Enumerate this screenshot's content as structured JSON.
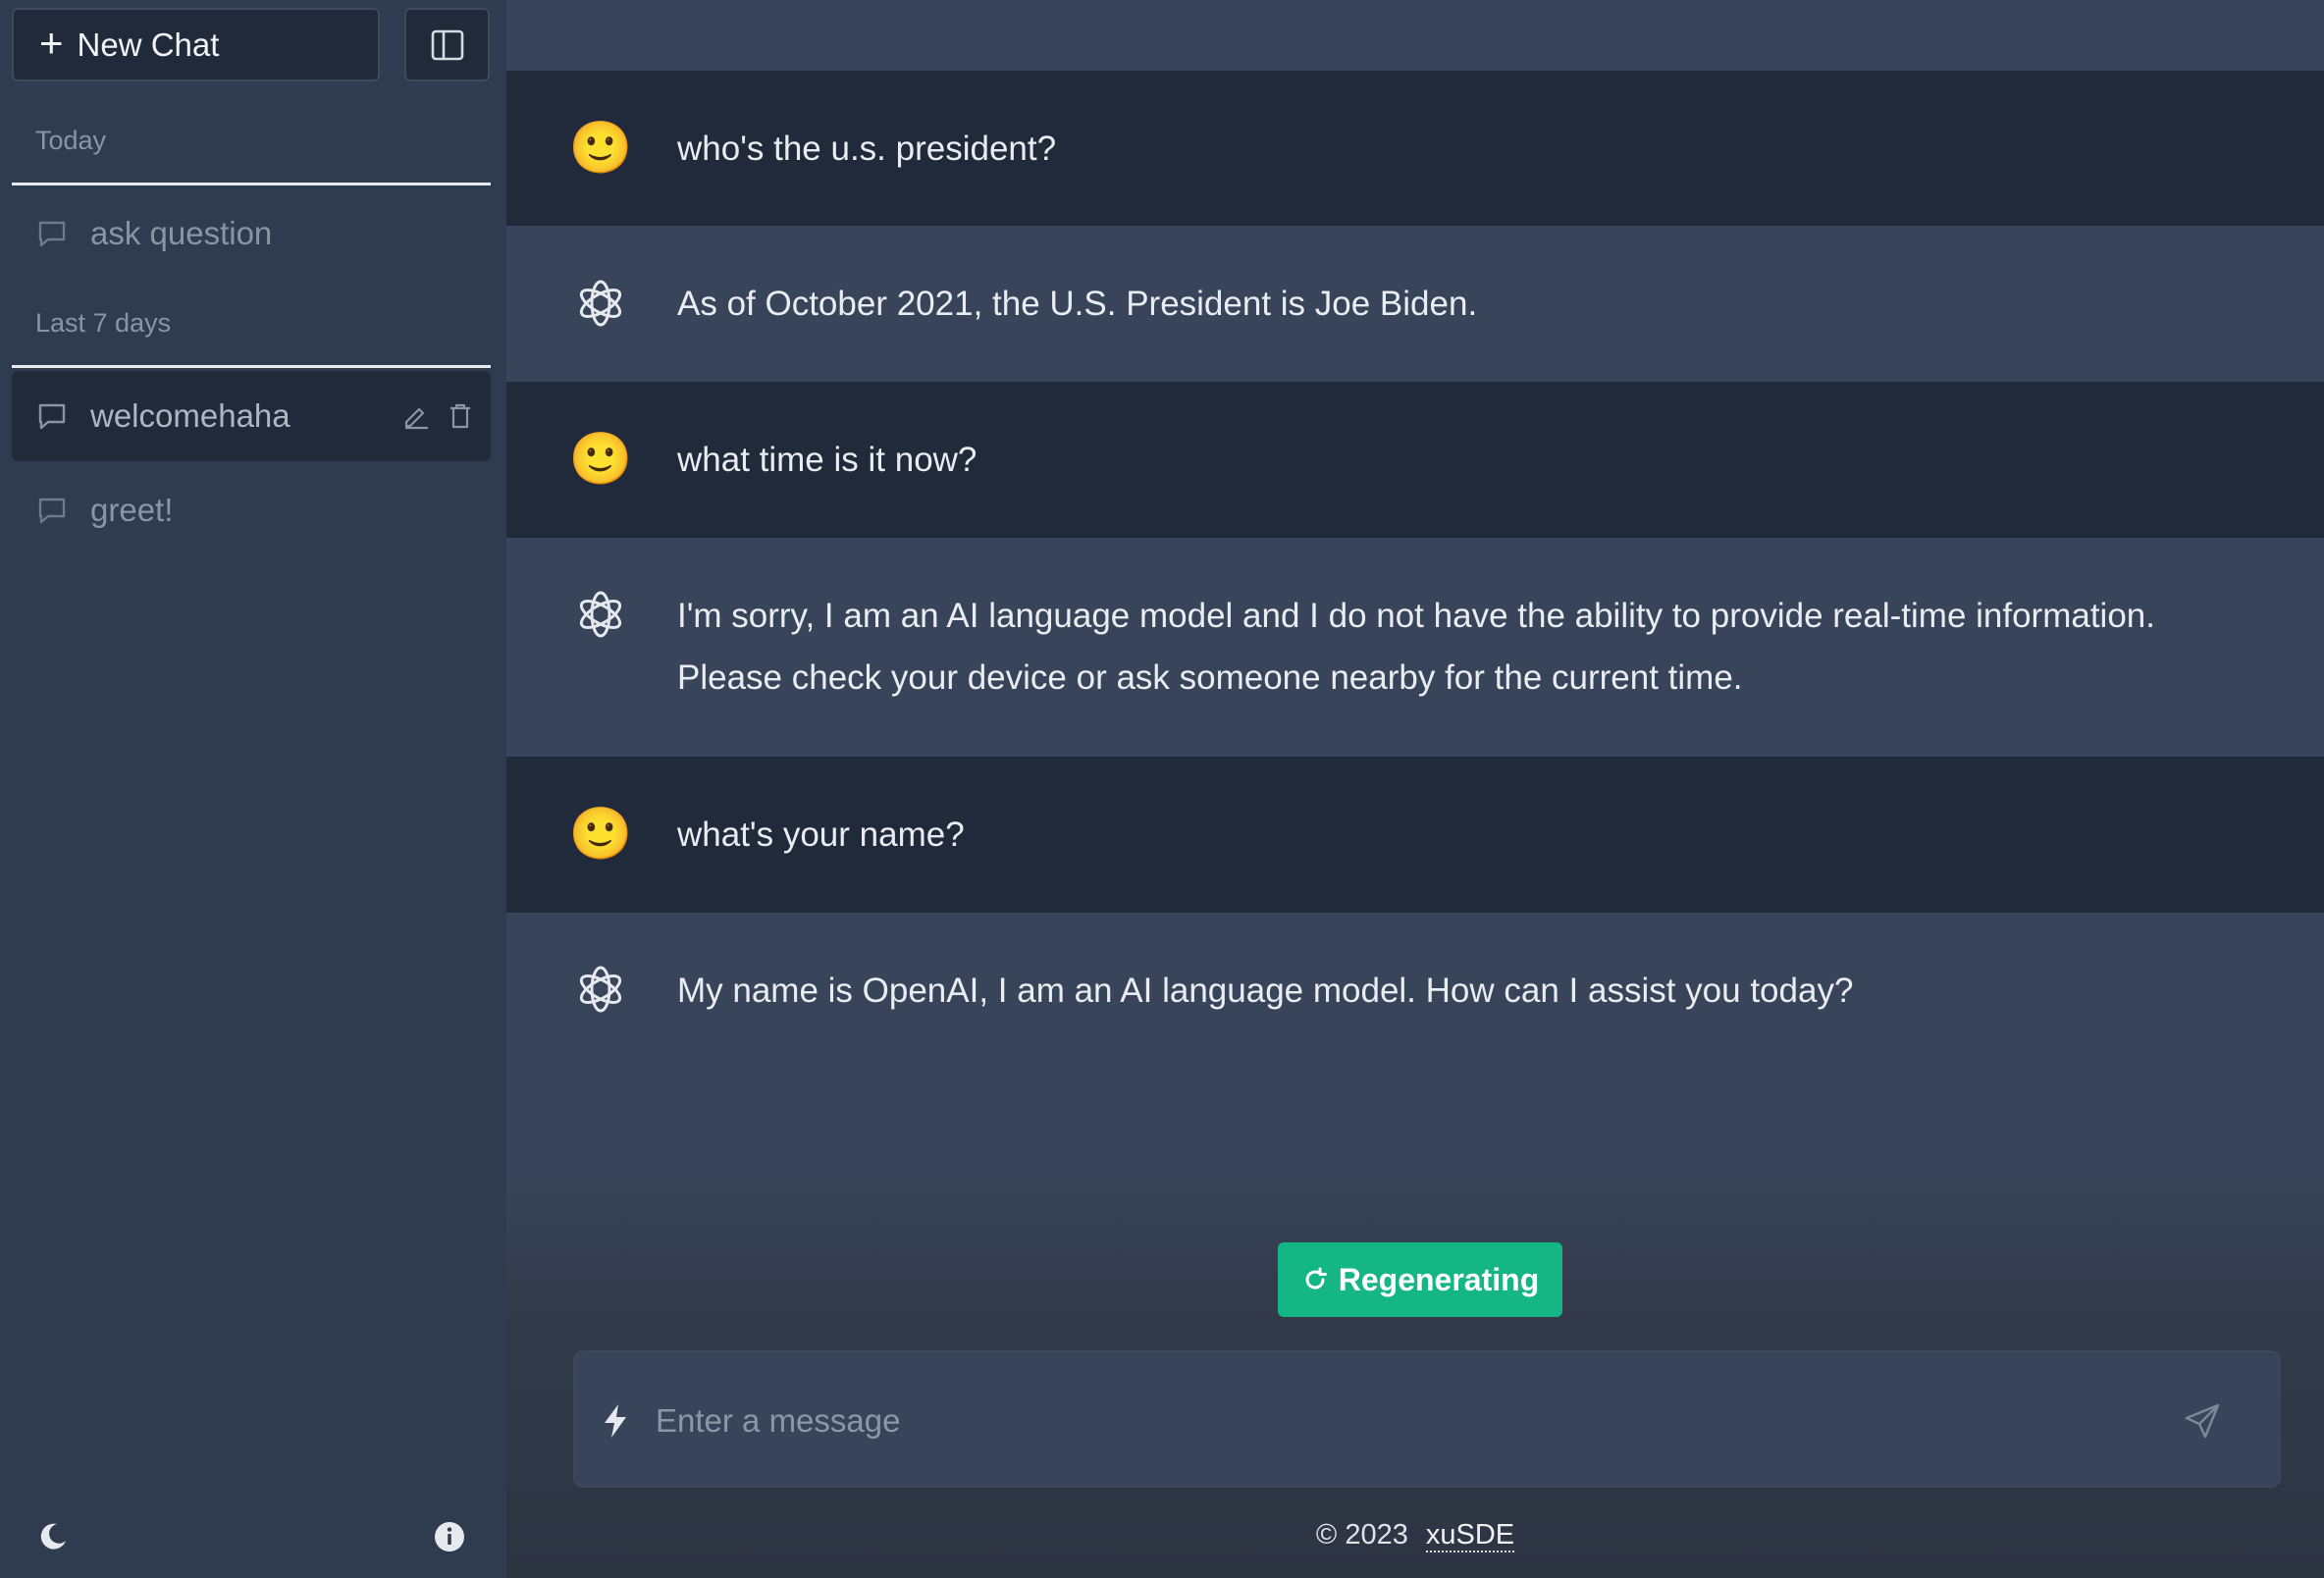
{
  "sidebar": {
    "new_chat_label": "New Chat",
    "sections": [
      {
        "label": "Today"
      },
      {
        "label": "Last 7 days"
      }
    ],
    "items": [
      {
        "label": "ask question"
      },
      {
        "label": "welcomehaha"
      },
      {
        "label": "greet!"
      }
    ]
  },
  "messages": [
    {
      "role": "user",
      "avatar": "🙂",
      "text": "who's the u.s. president?"
    },
    {
      "role": "assistant",
      "avatar": "openai-logo-icon",
      "text": "As of October 2021, the U.S. President is Joe Biden."
    },
    {
      "role": "user",
      "avatar": "🙂",
      "text": "what time is it now?"
    },
    {
      "role": "assistant",
      "avatar": "openai-logo-icon",
      "text": "I'm sorry, I am an AI language model and I do not have the ability to provide real-time information. Please check your device or ask someone nearby for the current time."
    },
    {
      "role": "user",
      "avatar": "🙂",
      "text": "what's your name?"
    },
    {
      "role": "assistant",
      "avatar": "openai-logo-icon",
      "text": "My name is OpenAI, I am an AI language model. How can I assist you today?"
    }
  ],
  "regenerate": {
    "label": "Regenerating"
  },
  "composer": {
    "placeholder": "Enter a message"
  },
  "footer": {
    "copyright": "© 2023",
    "author": "xuSDE"
  },
  "colors": {
    "accent": "#14b684",
    "user_row": "#212a3a",
    "bot_row": "#384459",
    "sidebar": "#2f3b4e"
  }
}
